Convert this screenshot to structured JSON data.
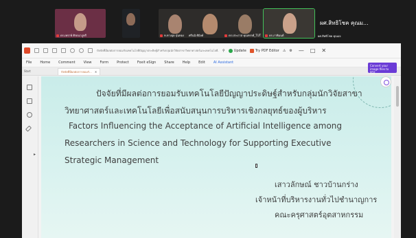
{
  "participants": [
    {
      "name": "ดร.เพราพ์ ศิรธนาภูทรี",
      "bg": "#5a2a3a"
    },
    {
      "name": "",
      "bg": "#1f2226"
    },
    {
      "name": "ท.ทางอุย ปุ่นทอง",
      "bg": "#2b2b2b"
    },
    {
      "name": "ศรีนนิ ศิมิงค์",
      "bg": "#3a2f28"
    },
    {
      "name": "ดร.ประภาส คุณทรรศ์_TUT",
      "bg": "#3b3732"
    },
    {
      "name": "ดร.ภาพิมนต์",
      "bg": "#2c2b2a"
    },
    {
      "name": "ผศ.สิทธิโชค คุณม...",
      "bg": "#1b1b1b"
    },
    {
      "name": "ผศ.สิทธิโชค คุณม่ง",
      "bg": "#1b1b1b"
    }
  ],
  "titlebar": {
    "title": "ปัจจัยที่มีผลต่อการยอมรับเทคโนโลยีปัญญาประดิษฐ์สำหรับกลุ่มนักวิจัยสาขาวิทยาศาสตร์และเทคโนโลยี...",
    "update": "Update",
    "try_pdf": "Try PDF Editor"
  },
  "menu": [
    "File",
    "Home",
    "Comment",
    "View",
    "Form",
    "Protect",
    "Foxit eSign",
    "Share",
    "Help",
    "Edit",
    "AI Assistant"
  ],
  "convert_button": "Convert your image files to PDF",
  "tabs": {
    "start": "Start",
    "document": "ปัจจัยที่มีผลต่อการยอมรั..."
  },
  "slide": {
    "th_title_1": "ปัจจัยที่มีผลต่อการยอมรับเทคโนโลยีปัญญาประดิษฐ์สำหรับกลุ่มนักวิจัยสาขา",
    "th_title_2": "วิทยาศาสตร์และเทคโนโลยีเพื่อสนับสนุนการบริหารเชิงกลยุทธ์ของผู้บริหาร",
    "en_title_1": "Factors Influencing the Acceptance of Artificial Intelligence among",
    "en_title_2": "Researchers in Science and Technology for Supporting Executive",
    "en_title_3": "Strategic Management",
    "author": "เสาวลักษณ์ ชาวบ้านกร่าง",
    "position": "เจ้าหน้าที่บริหารงานทั่วไปชำนาญการ",
    "faculty": "คณะครุศาสตร์อุตสาหกรรม"
  },
  "colors": {
    "accent": "#7c4ddc",
    "active_speaker": "#43c15a",
    "slide_bg": "#c9ece9"
  }
}
